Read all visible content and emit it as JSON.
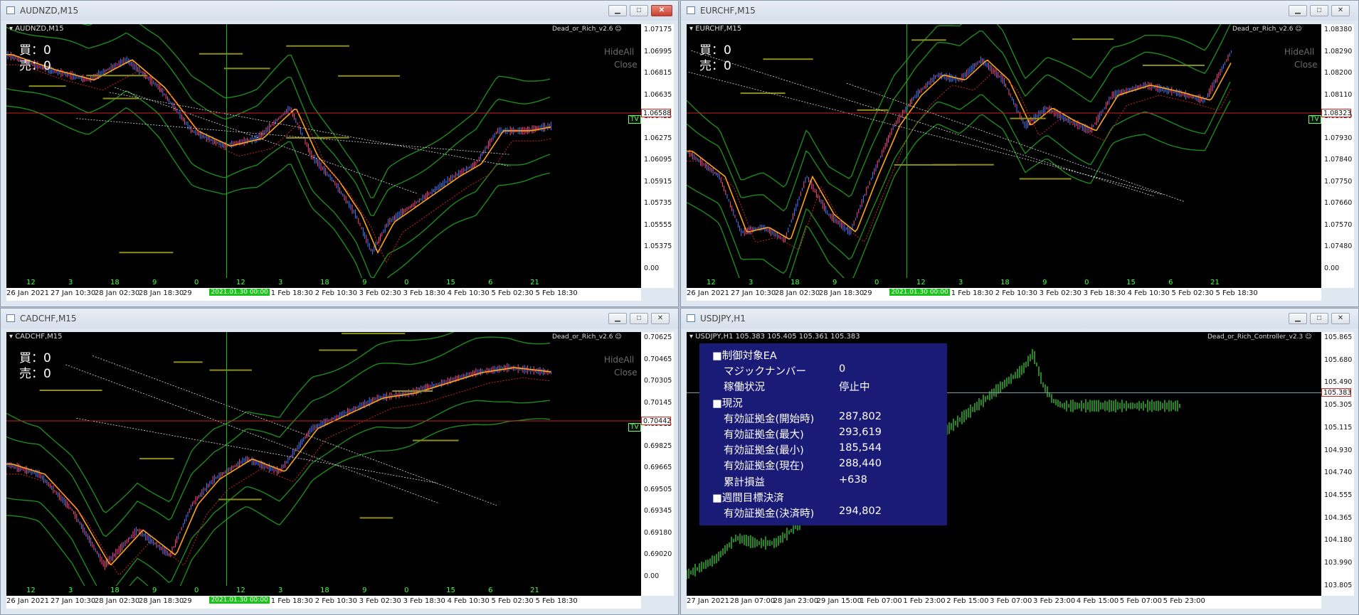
{
  "windows": [
    {
      "id": "audnzd",
      "title": "AUDNZD,M15",
      "symbol_label": "AUDNZD,M15",
      "ea_label": "Dead_or_Rich_v2.6",
      "buy": "買：0",
      "sell": "売：0",
      "hide_all": "HideAll",
      "close_btn": "Close",
      "tv": "TV",
      "current_price": "1.06588",
      "prices": [
        "1.07175",
        "1.06995",
        "1.06815",
        "1.06635",
        "1.06455",
        "1.06275",
        "1.06095",
        "1.05915",
        "1.05735",
        "1.05555",
        "1.05375",
        "0.00"
      ],
      "time_labels": [
        "26 Jan 2021",
        "27 Jan 10:30",
        "28 Jan 02:30",
        "28 Jan 18:30",
        "29",
        "2:30",
        "1 Feb 18:30",
        "2 Feb 10:30",
        "3 Feb 02:30",
        "3 Feb 18:30",
        "4 Feb 10:30",
        "5 Feb 02:30",
        "5 Feb 18:30"
      ],
      "hour_labels": [
        "12",
        "3",
        "18",
        "9",
        "0",
        "12",
        "3",
        "18",
        "9",
        "0",
        "15",
        "6",
        "21"
      ],
      "vline_date": "2021.01.30 00:00"
    },
    {
      "id": "eurchf",
      "title": "EURCHF,M15",
      "symbol_label": "EURCHF,M15",
      "ea_label": "Dead_or_Rich_v2.6",
      "buy": "買：0",
      "sell": "売：0",
      "hide_all": "HideAll",
      "close_btn": "Close",
      "tv": "TV",
      "current_price": "1.08323",
      "prices": [
        "1.08380",
        "1.08290",
        "1.08200",
        "1.08110",
        "1.08020",
        "1.07930",
        "1.07840",
        "1.07750",
        "1.07660",
        "1.07570",
        "1.07480",
        "0.00"
      ],
      "time_labels": [
        "26 Jan 2021",
        "27 Jan 10:30",
        "28 Jan 02:30",
        "28 Jan 18:30",
        "29",
        "2:30",
        "1 Feb 18:30",
        "2 Feb 10:30",
        "3 Feb 02:30",
        "3 Feb 18:30",
        "4 Feb 10:30",
        "5 Feb 02:30",
        "5 Feb 18:30"
      ],
      "hour_labels": [
        "12",
        "3",
        "18",
        "9",
        "0",
        "12",
        "3",
        "18",
        "9",
        "0",
        "15",
        "6",
        "21"
      ],
      "vline_date": "2021.01.30 00:00"
    },
    {
      "id": "cadchf",
      "title": "CADCHF,M15",
      "symbol_label": "CADCHF,M15",
      "ea_label": "Dead_or_Rich_v2.6",
      "buy": "買：0",
      "sell": "売：0",
      "hide_all": "HideAll",
      "close_btn": "Close",
      "tv": "TV",
      "current_price": "0.70442",
      "prices": [
        "0.70625",
        "0.70465",
        "0.70305",
        "0.70145",
        "0.69985",
        "0.69825",
        "0.69665",
        "0.69505",
        "0.69345",
        "0.69180",
        "0.69020",
        "0.00"
      ],
      "time_labels": [
        "26 Jan 2021",
        "27 Jan 10:30",
        "28 Jan 02:30",
        "28 Jan 18:30",
        "29",
        "2:30",
        "1 Feb 18:30",
        "2 Feb 10:30",
        "3 Feb 02:30",
        "3 Feb 18:30",
        "4 Feb 10:30",
        "5 Feb 02:30",
        "5 Feb 18:30"
      ],
      "hour_labels": [
        "12",
        "3",
        "18",
        "9",
        "0",
        "12",
        "3",
        "18",
        "9",
        "0",
        "15",
        "6",
        "21"
      ],
      "vline_date": "2021.01.30 00:00"
    },
    {
      "id": "usdjpy",
      "title": "USDJPY,H1",
      "symbol_label": "USDJPY,H1  105.383 105.405 105.361 105.383",
      "ea_label": "Dead_or_Rich_Controller_v2.3",
      "current_price": "105.383",
      "prices": [
        "105.865",
        "105.680",
        "105.490",
        "105.305",
        "105.115",
        "104.930",
        "104.740",
        "104.555",
        "104.365",
        "104.180",
        "103.990",
        "103.805"
      ],
      "time_labels": [
        "27 Jan 2021",
        "28 Jan 07:00",
        "28 Jan 23:00",
        "29 Jan 15:00",
        "1 Feb 07:00",
        "1 Feb 23:00",
        "2 Feb 15:00",
        "3 Feb 07:00",
        "3 Feb 23:00",
        "4 Feb 15:00",
        "5 Feb 07:00",
        "5 Feb 23:00"
      ],
      "panel": {
        "rows": [
          {
            "label": "■制御対象EA",
            "value": ""
          },
          {
            "label": "マジックナンバー",
            "value": "0"
          },
          {
            "label": "稼働状況",
            "value": "停止中"
          },
          {
            "label": "■現況",
            "value": ""
          },
          {
            "label": "有効証拠金(開始時)",
            "value": "287,802"
          },
          {
            "label": "有効証拠金(最大)",
            "value": "293,619"
          },
          {
            "label": "有効証拠金(最小)",
            "value": "185,544"
          },
          {
            "label": "有効証拠金(現在)",
            "value": "288,440"
          },
          {
            "label": "累計損益",
            "value": "+638"
          },
          {
            "label": "■週間目標決済",
            "value": ""
          },
          {
            "label": "有効証拠金(決済時)",
            "value": "294,802"
          }
        ]
      }
    }
  ]
}
